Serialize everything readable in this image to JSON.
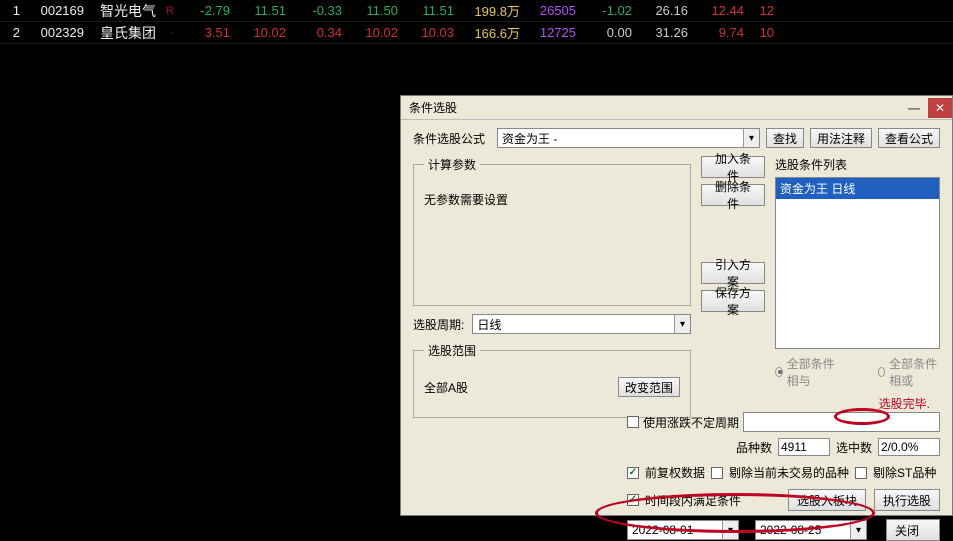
{
  "stocks": [
    {
      "idx": "1",
      "code": "002169",
      "name": "智光电气",
      "mark": "R",
      "chg": "-2.79",
      "v1": "11.51",
      "v2": "-0.33",
      "v3": "11.50",
      "v4": "11.51",
      "vol": "199.8万",
      "turn": "26505",
      "v5": "-1.02",
      "v6": "26.16",
      "v7": "12.44",
      "v8": "12"
    },
    {
      "idx": "2",
      "code": "002329",
      "name": "皇氏集团",
      "mark": "·",
      "chg": "3.51",
      "v1": "10.02",
      "v2": "0.34",
      "v3": "10.02",
      "v4": "10.03",
      "vol": "166.6万",
      "turn": "12725",
      "v5": "0.00",
      "v6": "31.26",
      "v7": "9.74",
      "v8": "10"
    }
  ],
  "dialog": {
    "title": "条件选股",
    "formula_label": "条件选股公式",
    "formula_value": "资金为王    -",
    "btn_find": "查找",
    "btn_usage": "用法注释",
    "btn_view_formula": "查看公式",
    "group_calc": "计算参数",
    "no_params": "无参数需要设置",
    "btn_add": "加入条件",
    "btn_del": "删除条件",
    "btn_import": "引入方案",
    "btn_save": "保存方案",
    "cond_list_label": "选股条件列表",
    "cond_item": "资金为王 日线",
    "period_label": "选股周期:",
    "period_value": "日线",
    "group_scope": "选股范围",
    "scope_value": "全部A股",
    "btn_change_scope": "改变范围",
    "radio_and": "全部条件相与",
    "radio_or": "全部条件相或",
    "status": "选股完毕.",
    "use_period_label": "使用涨跌不定周期",
    "count_kind_label": "品种数",
    "count_kind": "4911",
    "count_sel_label": "选中数",
    "count_sel": "2/0.0%",
    "chk_fq": "前复权数据",
    "chk_remove_nontrade": "剔除当前未交易的品种",
    "chk_remove_st": "剔除ST品种",
    "chk_time": "时间段内满足条件",
    "btn_add_block": "选股入板块",
    "btn_exec": "执行选股",
    "date_from": "2022-08-01",
    "date_sep": "-",
    "date_to": "2022-08-25",
    "btn_close": "关闭"
  }
}
